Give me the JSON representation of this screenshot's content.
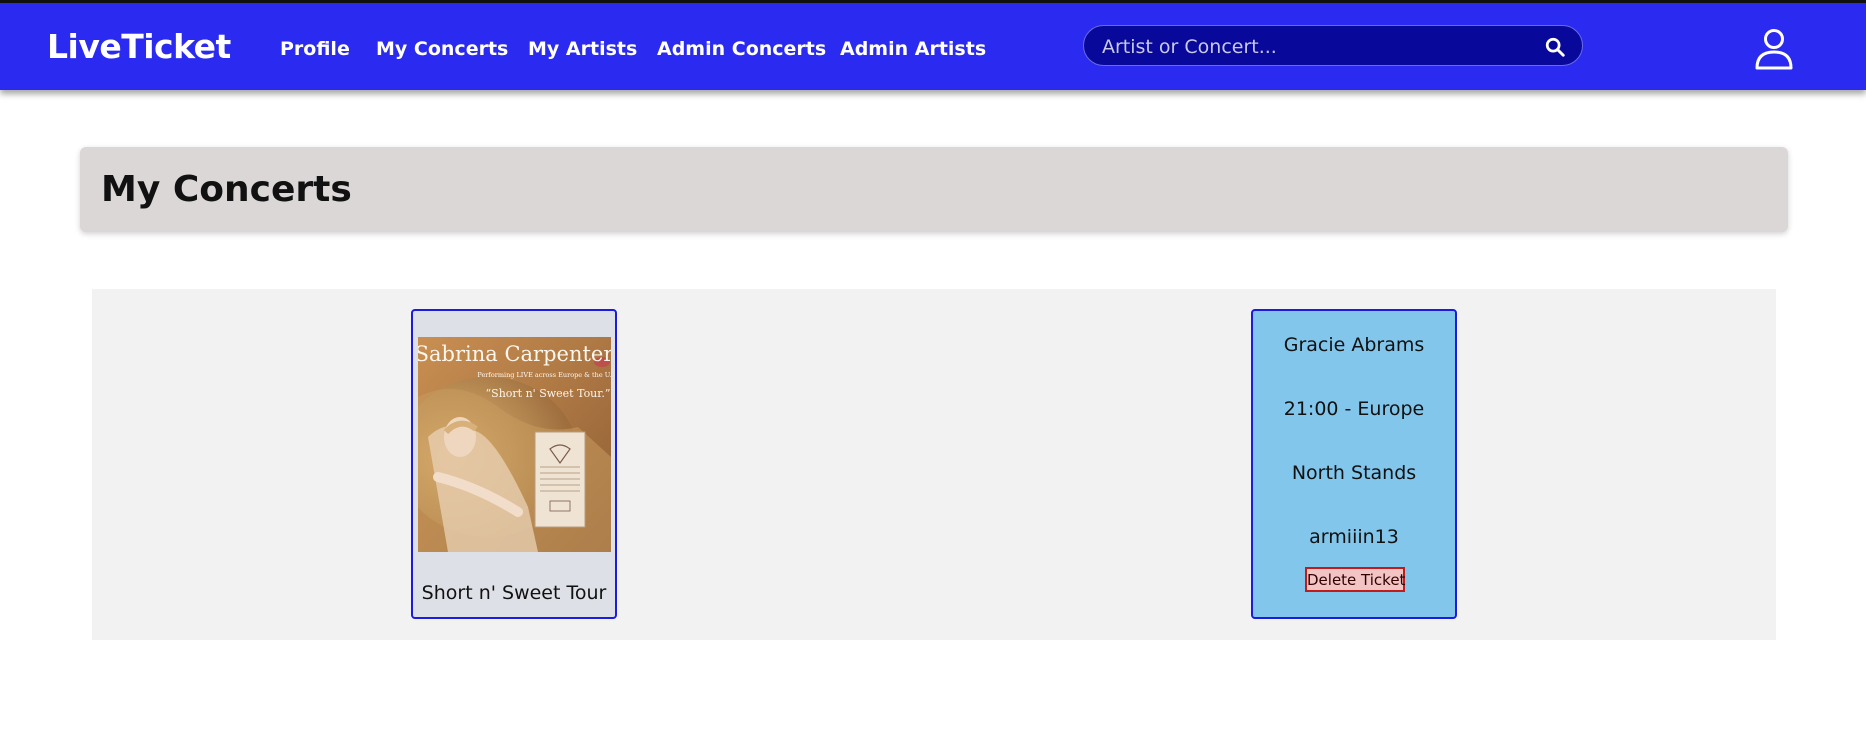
{
  "header": {
    "brand": "LiveTicket",
    "nav": [
      {
        "label": "Profile"
      },
      {
        "label": "My Concerts"
      },
      {
        "label": "My Artists"
      },
      {
        "label": "Admin Concerts"
      },
      {
        "label": "Admin Artists"
      }
    ],
    "search": {
      "placeholder": "Artist or Concert...",
      "value": "",
      "icon": "search-icon"
    },
    "user_icon": "user-icon"
  },
  "main": {
    "title": "My Concerts",
    "concert_card": {
      "poster": {
        "headline": "Sabrina Carpenter",
        "subline": "Performing LIVE across Europe & the U.K.",
        "tour_quote": "“Short n' Sweet Tour.”"
      },
      "title": "Short n' Sweet Tour"
    },
    "ticket_card": {
      "artist": "Gracie Abrams",
      "time_location": "21:00 - Europe",
      "section": "North Stands",
      "username": "armiiin13",
      "delete_label": "Delete Ticket"
    }
  },
  "colors": {
    "navbar": "#2a2af0",
    "search_bg": "#08089a",
    "title_panel": "#dbd7d7",
    "ticket_card": "#82c6ec",
    "card_border": "#1c1ce0",
    "delete_border": "#c01c1c"
  }
}
